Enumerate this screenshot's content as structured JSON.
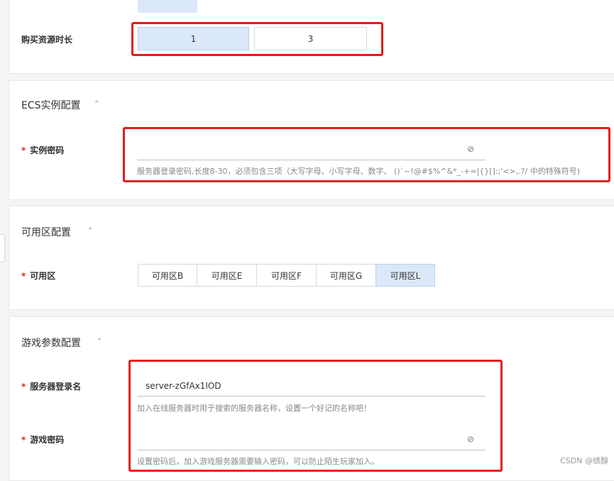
{
  "duration": {
    "label": "购买资源时长",
    "options": [
      "1",
      "3"
    ],
    "selected": "1"
  },
  "ecs": {
    "title": "ECS实例配置",
    "password_label": "实例密码",
    "password_hint": "服务器登录密码,长度8-30，必须包含三项（大写字母、小写字母、数字、 ()`~!@#$%^&*_-+=|{}[]:;'<>,.?/ 中的特殊符号)"
  },
  "zone": {
    "title": "可用区配置",
    "label": "可用区",
    "options": [
      "可用区B",
      "可用区E",
      "可用区F",
      "可用区G",
      "可用区L"
    ],
    "selected": "可用区L"
  },
  "game": {
    "title": "游戏参数配置",
    "login_name_label": "服务器登录名",
    "login_name_value": "server-zGfAx1IOD",
    "login_name_hint": "加入在线服务器时用于搜索的服务器名称，设置一个好记的名称吧！",
    "game_password_label": "游戏密码",
    "game_password_hint": "设置密码后，加入游戏服务器需要输入密码，可以防止陌生玩家加入。"
  },
  "icons": {
    "collapse": "chevron-up-icon",
    "eye_off": "eye-off-icon"
  },
  "watermark": "CSDN @绩醇",
  "colors": {
    "selected_bg": "#dbe8fa",
    "required": "#e02424",
    "highlight_box": "#e31b1b"
  }
}
